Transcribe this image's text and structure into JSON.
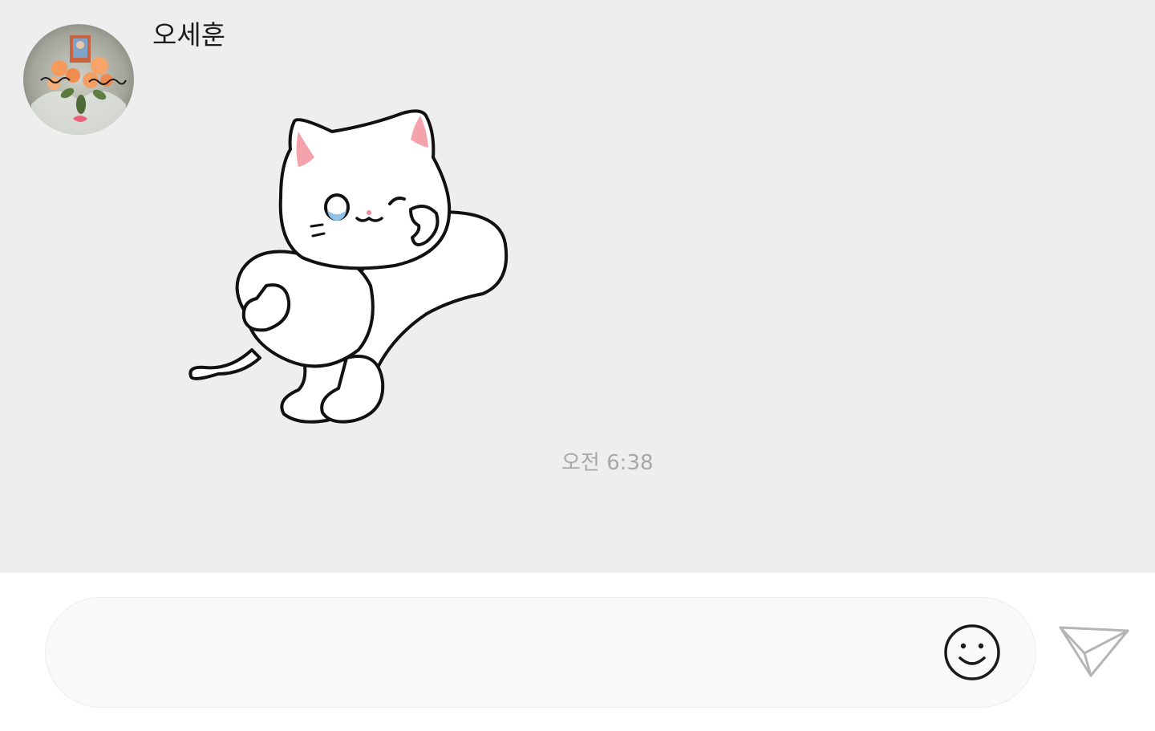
{
  "chat": {
    "sender_name": "오세훈",
    "timestamp": "오전 6:38",
    "avatar_icon": "profile-photo-flower-bouquet",
    "sticker_icon": "white-cat-winking-sticker"
  },
  "composer": {
    "input_value": "",
    "input_placeholder": "",
    "emoji_icon": "smiley-face-icon",
    "send_icon": "paper-plane-icon"
  },
  "colors": {
    "chat_background": "#eeeeee",
    "composer_background": "#ffffff",
    "input_background": "#f9f9f9",
    "name_text": "#1c1c1c",
    "timestamp_text": "#a8a8a8"
  }
}
